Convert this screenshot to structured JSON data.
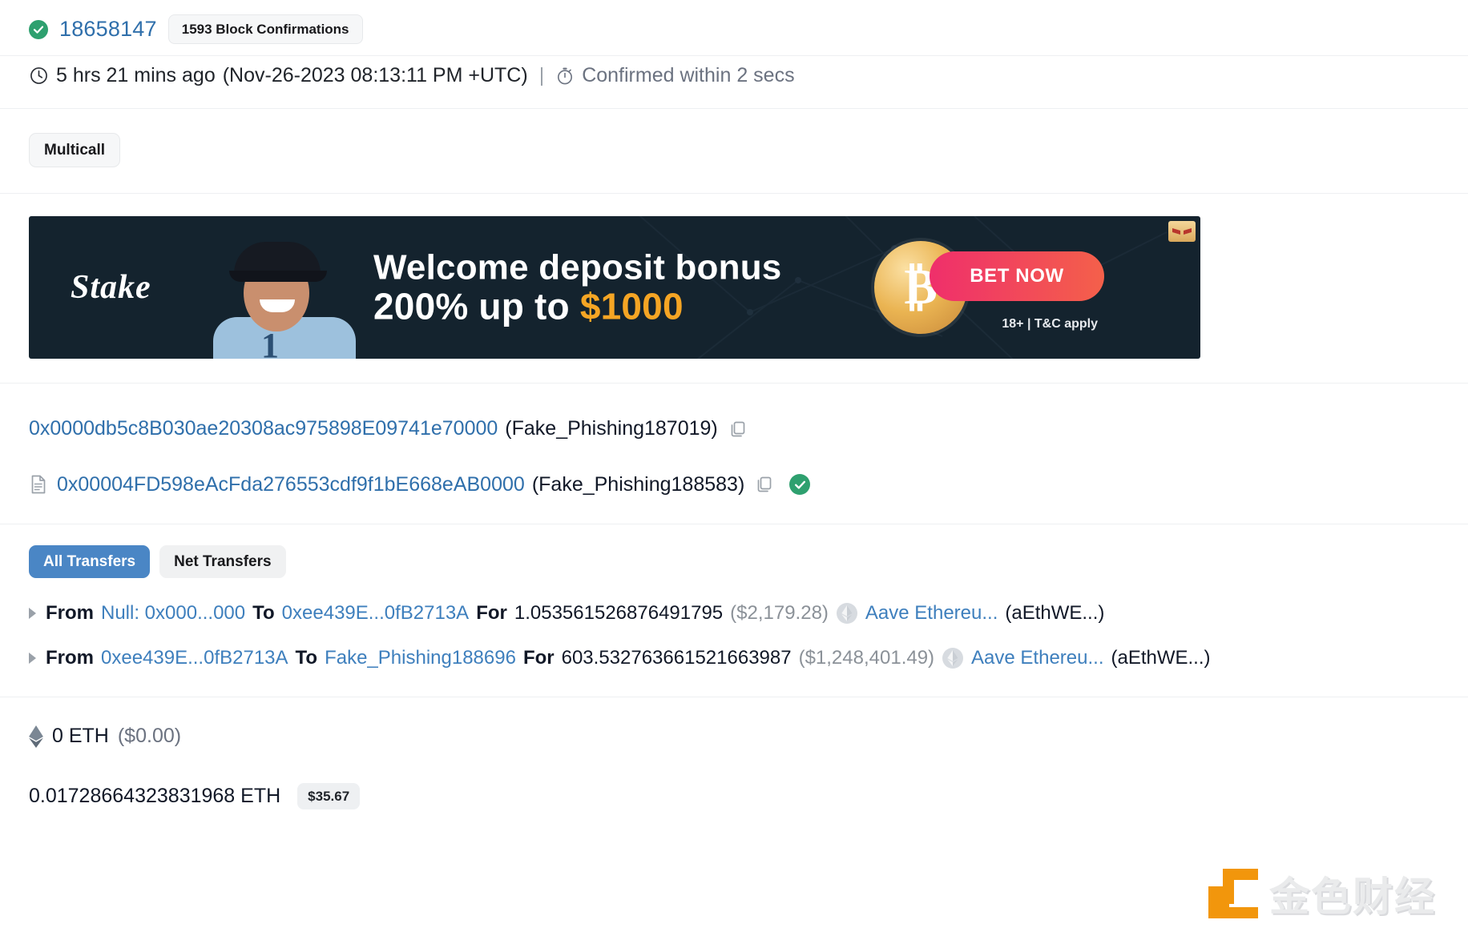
{
  "block": {
    "status_icon": "check-circle-icon",
    "number": "18658147",
    "confirmations_label": "1593 Block Confirmations"
  },
  "timestamp": {
    "clock_icon": "clock-icon",
    "relative": "5 hrs 21 mins ago",
    "absolute": "(Nov-26-2023 08:13:11 PM +UTC)",
    "separator": "|",
    "stopwatch_icon": "stopwatch-icon",
    "confirmed_text": "Confirmed within 2 secs"
  },
  "method": {
    "label": "Multicall"
  },
  "ad": {
    "brand": "Stake",
    "headline_line1": "Welcome deposit bonus",
    "headline_line2_prefix": "200% up to ",
    "headline_amount": "$1000",
    "coin_symbol": "₿",
    "cta_label": "BET NOW",
    "legal": "18+ | T&C apply",
    "close_icon": "ad-close-icon",
    "player_number": "1",
    "bg_color": "#14232e",
    "amount_color": "#f5a524"
  },
  "addresses": {
    "from": {
      "address": "0x0000db5c8B030ae20308ac975898E09741e70000",
      "tag": "(Fake_Phishing187019)",
      "copy_icon": "copy-icon"
    },
    "to": {
      "contract_icon": "contract-document-icon",
      "address": "0x00004FD598eAcFda276553cdf9f1bE668eAB0000",
      "tag": "(Fake_Phishing188583)",
      "copy_icon": "copy-icon",
      "verified_icon": "verified-check-icon"
    }
  },
  "transfers": {
    "tabs": [
      {
        "label": "All Transfers",
        "active": true
      },
      {
        "label": "Net Transfers",
        "active": false
      }
    ],
    "rows": [
      {
        "from_label": "From",
        "from_value": "Null: 0x000...000",
        "to_label": "To",
        "to_value": "0xee439E...0fB2713A",
        "for_label": "For",
        "amount": "1.053561526876491795",
        "usd": "($2,179.28)",
        "token_icon": "eth-token-icon",
        "token_name": "Aave Ethereu...",
        "token_symbol": "(aEthWE...)"
      },
      {
        "from_label": "From",
        "from_value": "0xee439E...0fB2713A",
        "to_label": "To",
        "to_value": "Fake_Phishing188696",
        "for_label": "For",
        "amount": "603.532763661521663987",
        "usd": "($1,248,401.49)",
        "token_icon": "eth-token-icon",
        "token_name": "Aave Ethereu...",
        "token_symbol": "(aEthWE...)"
      }
    ]
  },
  "value": {
    "eth_icon": "ethereum-diamond-icon",
    "amount": "0 ETH",
    "usd": "($0.00)"
  },
  "fee": {
    "amount": "0.01728664323831968 ETH",
    "usd_badge": "$35.67"
  },
  "watermark": {
    "text": "金色财经",
    "mark_icon": "jinse-logo-icon",
    "mark_color": "#f29100"
  },
  "colors": {
    "link": "#2f6fab",
    "accent_blue": "#4a86c5",
    "success_green": "#2ea06f",
    "muted": "#6b7280"
  }
}
